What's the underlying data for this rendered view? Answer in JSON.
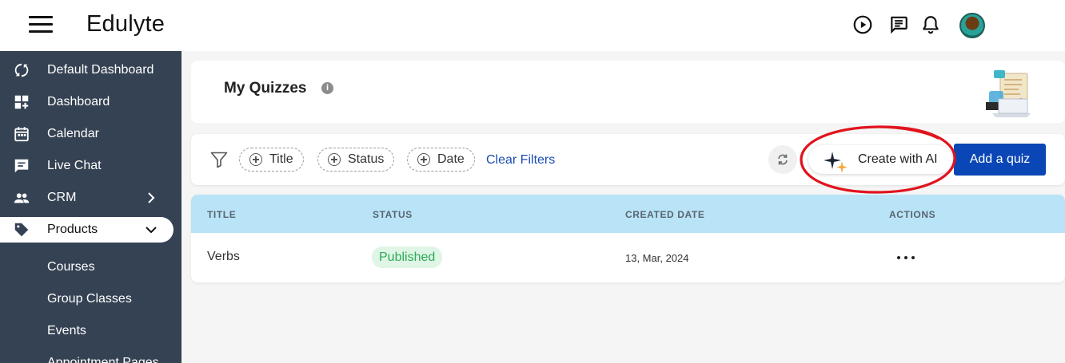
{
  "app": {
    "brand": "Edulyte"
  },
  "sidebar": {
    "items": [
      {
        "label": "Default Dashboard",
        "icon": "dashboard-swap-icon"
      },
      {
        "label": "Dashboard",
        "icon": "dashboard-add-icon"
      },
      {
        "label": "Calendar",
        "icon": "calendar-icon"
      },
      {
        "label": "Live Chat",
        "icon": "chat-icon"
      },
      {
        "label": "CRM",
        "icon": "people-icon"
      },
      {
        "label": "Products",
        "icon": "tag-icon"
      }
    ],
    "sub_items": [
      "Courses",
      "Group Classes",
      "Events",
      "Appointment Pages"
    ]
  },
  "page": {
    "title": "My Quizzes"
  },
  "filters": {
    "chips": [
      "Title",
      "Status",
      "Date"
    ],
    "clear_label": "Clear Filters"
  },
  "toolbar": {
    "ai_label": "Create with AI",
    "add_label": "Add a quiz"
  },
  "table": {
    "headers": [
      "TITLE",
      "STATUS",
      "CREATED DATE",
      "ACTIONS"
    ],
    "rows": [
      {
        "title": "Verbs",
        "status": "Published",
        "created": "13, Mar, 2024"
      }
    ]
  },
  "colors": {
    "sidebar": "#354253",
    "primary": "#0a46b6",
    "table_header": "#b9e4f8",
    "published_text": "#2eaa57",
    "published_bg": "#dff5e6",
    "annotation": "#e0141e"
  }
}
